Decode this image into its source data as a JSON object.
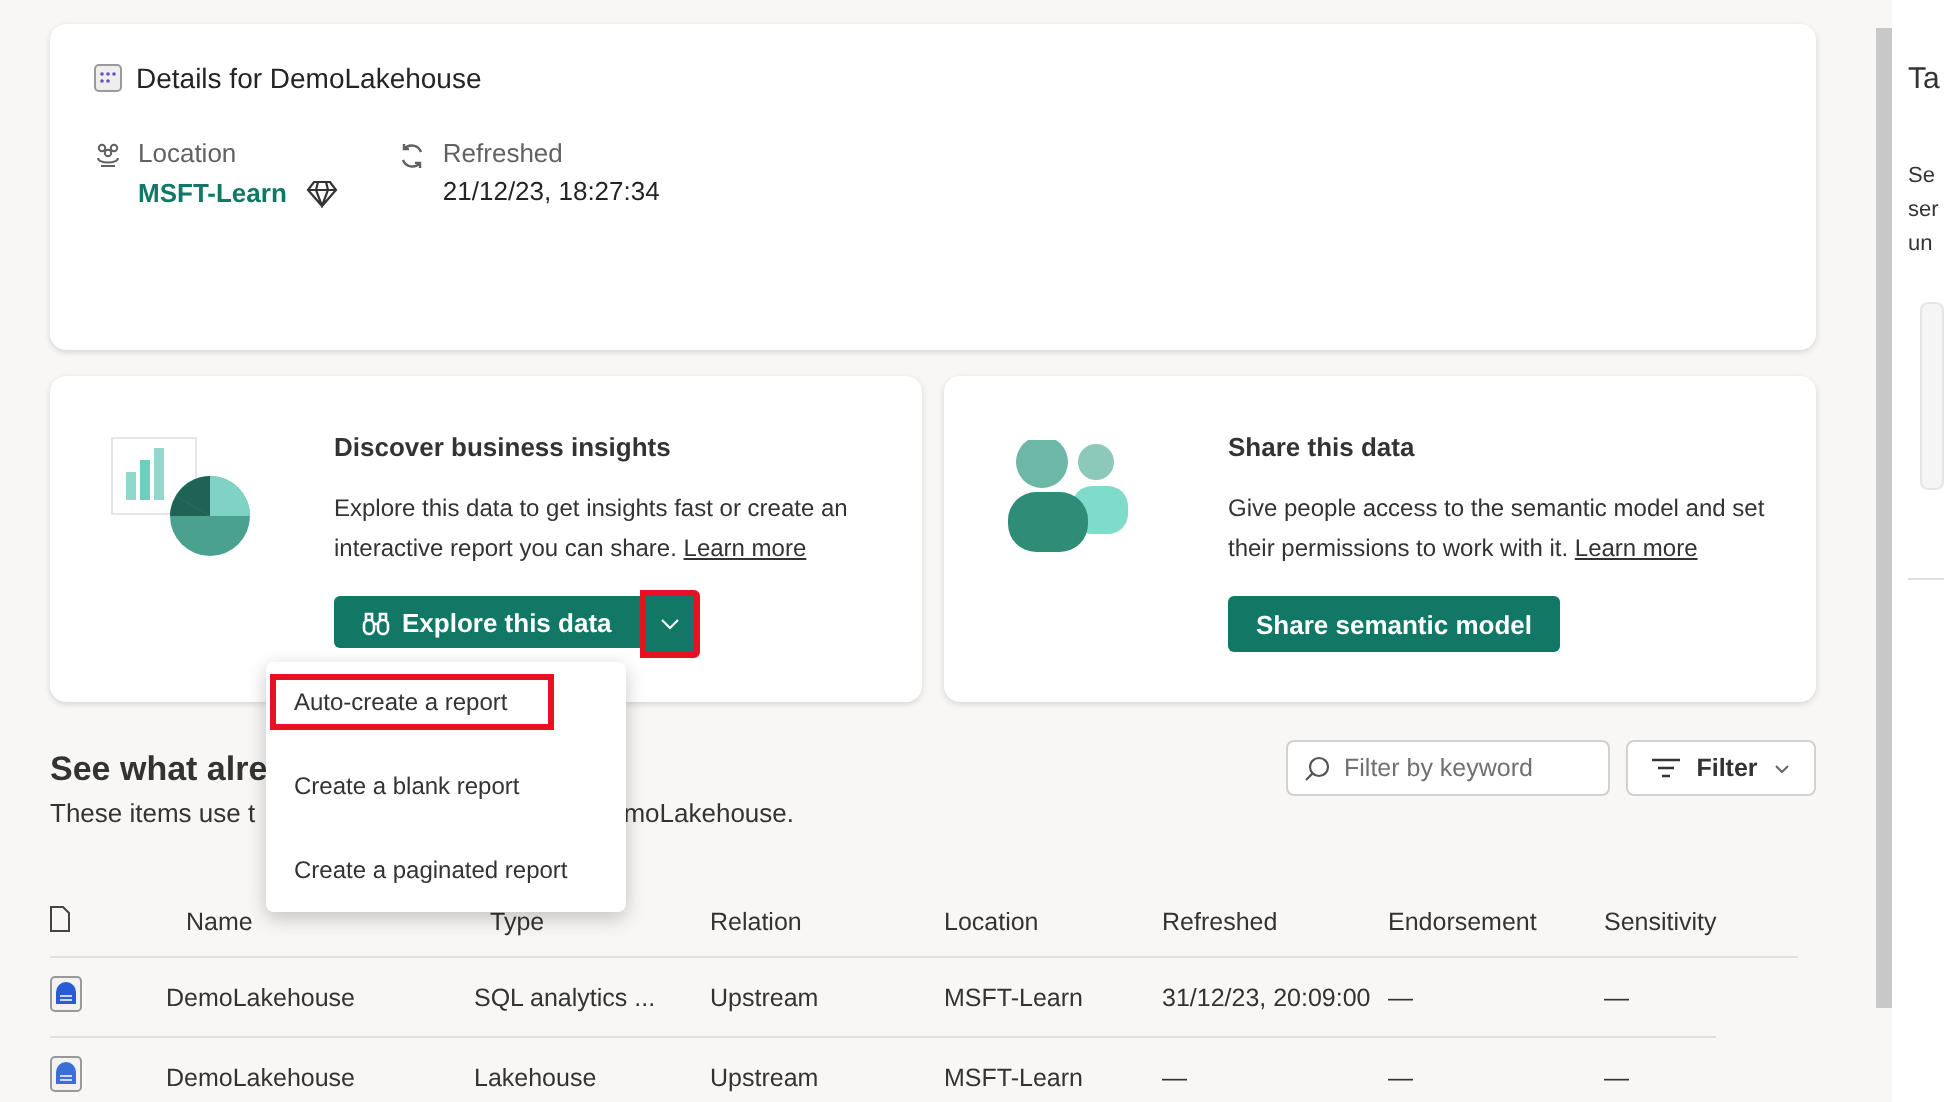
{
  "details": {
    "title": "Details for DemoLakehouse",
    "fields": [
      {
        "kind": "location",
        "label": "Location",
        "value": "MSFT-Learn",
        "link": true,
        "endorsed": true
      },
      {
        "kind": "refreshed",
        "label": "Refreshed",
        "value": "21/12/23, 18:27:34",
        "link": false,
        "endorsed": false
      }
    ]
  },
  "cards": [
    {
      "kind": "insights",
      "title": "Discover business insights",
      "text": "Explore this data to get insights fast or create an interactive report you can share.",
      "link": "Learn more",
      "button": "Explore this data",
      "split": true,
      "split_highlighted": true
    },
    {
      "kind": "share",
      "title": "Share this data",
      "text": "Give people access to the semantic model and set their permissions to work with it.",
      "link": "Learn more",
      "button": "Share semantic model",
      "split": false
    }
  ],
  "menu": {
    "items": [
      {
        "label": "Auto-create a report",
        "highlighted": true
      },
      {
        "label": "Create a blank report",
        "highlighted": false
      },
      {
        "label": "Create a paginated report",
        "highlighted": false
      }
    ]
  },
  "related": {
    "heading": "See what alre",
    "subtitle_start": "These items use t",
    "subtitle_end": "moLakehouse.",
    "search": {
      "placeholder": "Filter by keyword"
    },
    "filter_button": "Filter",
    "columns": [
      "Name",
      "Type",
      "Relation",
      "Location",
      "Refreshed",
      "Endorsement",
      "Sensitivity"
    ],
    "rows": [
      {
        "kind": "sql",
        "cells": [
          "DemoLakehouse",
          "SQL analytics ...",
          "Upstream",
          "MSFT-Learn",
          "31/12/23, 20:09:00",
          "—",
          "—"
        ]
      },
      {
        "kind": "lakehouse",
        "cells": [
          "DemoLakehouse",
          "Lakehouse",
          "Upstream",
          "MSFT-Learn",
          "—",
          "—",
          "—"
        ]
      }
    ]
  },
  "side_panel": {
    "title": "Ta",
    "lines": [
      "Se",
      "ser",
      "un"
    ]
  }
}
